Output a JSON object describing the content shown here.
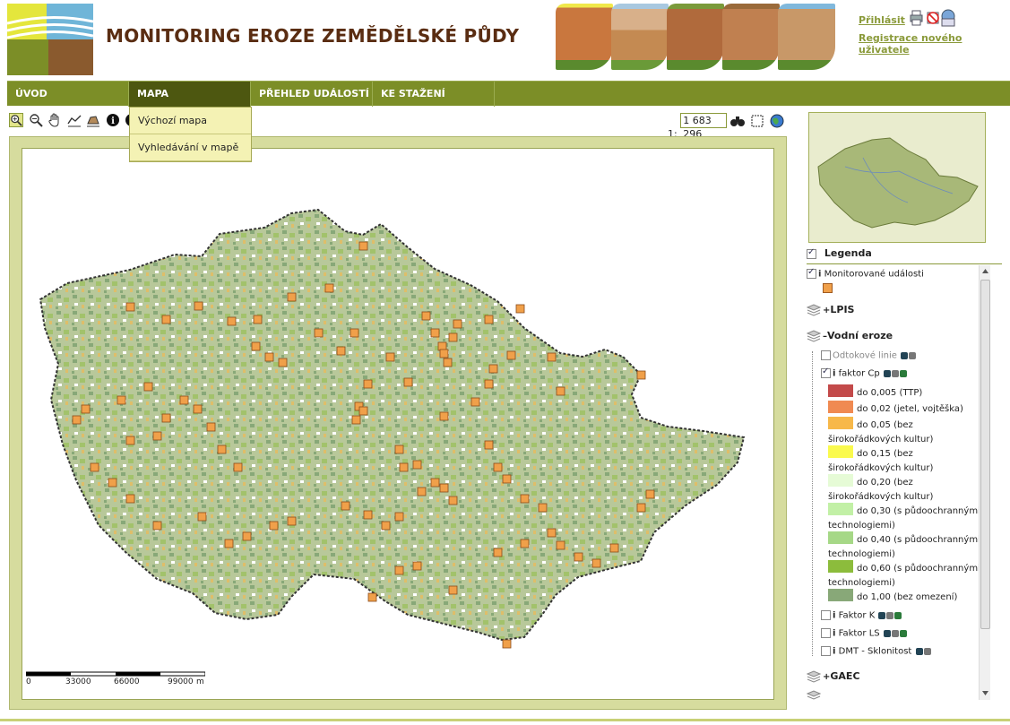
{
  "header": {
    "title": "MONITORING EROZE ZEMĚDĚLSKÉ PŮDY",
    "login": "Přihlásit",
    "register": "Registrace nového uživatele"
  },
  "nav": [
    {
      "label": "ÚVOD"
    },
    {
      "label": "MAPA"
    },
    {
      "label": "PŘEHLED UDÁLOSTÍ"
    },
    {
      "label": "KE STAŽENÍ"
    }
  ],
  "submenu": [
    "Výchozí mapa",
    "Vyhledávání v mapě"
  ],
  "map": {
    "scale_prefix": "1:",
    "scale_value": "1 683 296",
    "scalebar_labels": [
      "0",
      "33000",
      "66000",
      "99000",
      "m"
    ]
  },
  "legend": {
    "title": "Legenda",
    "monitored": "Monitorované události",
    "lpis": "LPIS",
    "vodni_eroze": "Vodní eroze",
    "odtokove": "Odtokové linie",
    "faktor_cp": "faktor Cp",
    "cp_classes": [
      {
        "color": "#c34a4a",
        "lines": [
          "do 0,005 (TTP)"
        ]
      },
      {
        "color": "#f08a52",
        "lines": [
          "do 0,02 (jetel, vojtěška)"
        ]
      },
      {
        "color": "#f7b84a",
        "lines": [
          "do 0,05 (bez",
          "širokořádkových kultur)"
        ]
      },
      {
        "color": "#fafa4e",
        "lines": [
          "do 0,15 (bez",
          "širokořádkových kultur)"
        ]
      },
      {
        "color": "#e6fbd6",
        "lines": [
          "do 0,20 (bez",
          "širokořádkových kultur)"
        ]
      },
      {
        "color": "#c2f0a6",
        "lines": [
          "do 0,30 (s půdoochrannými",
          "technologiemi)"
        ]
      },
      {
        "color": "#a6d887",
        "lines": [
          "do 0,40 (s půdoochrannými",
          "technologiemi)"
        ]
      },
      {
        "color": "#8cbc3c",
        "lines": [
          "do 0,60 (s půdoochrannými",
          "technologiemi)"
        ]
      },
      {
        "color": "#88a878",
        "lines": [
          "do 1,00 (bez omezení)"
        ]
      }
    ],
    "faktor_k": "Faktor K",
    "faktor_ls": "Faktor LS",
    "dmt": "DMT - Sklonitost",
    "gaec": "GAEC",
    "info_prefix": "i"
  },
  "colors": {
    "nav_bg": "#7c8e27",
    "nav_active": "#4d5710",
    "title": "#5a2d12",
    "link": "#8a9a3a",
    "event_marker": "#f0a04a"
  }
}
